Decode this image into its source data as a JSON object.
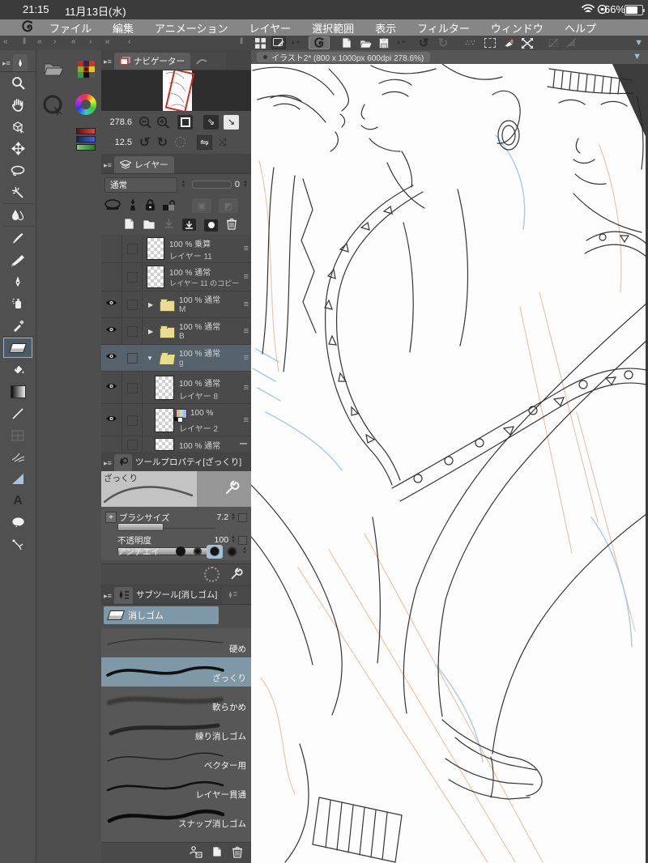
{
  "colors": {
    "selection": "#7e98a8",
    "folder_yellow": "#e6dd8f",
    "navigator_frame": "#cf2b24"
  },
  "status_bar": {
    "time": "21:15",
    "date": "11月13日(水)",
    "battery_percent": "66%"
  },
  "menu_bar": {
    "items": [
      "ファイル",
      "編集",
      "アニメーション",
      "レイヤー",
      "選択範囲",
      "表示",
      "フィルター",
      "ウィンドウ",
      "ヘルプ"
    ]
  },
  "document": {
    "tab_label": "イラスト2* (800 x 1000px 600dpi 278.6%)"
  },
  "navigator": {
    "tab": "ナビゲーター",
    "zoom_value": "278.6",
    "rotate_value": "12.5"
  },
  "layer_panel": {
    "tab": "レイヤー",
    "blend_mode": "通常",
    "opacity_value": "0",
    "rows": [
      {
        "percent": "100 %",
        "mode": "乗算",
        "name": "レイヤー 11"
      },
      {
        "percent": "100 %",
        "mode": "通常",
        "name": "レイヤー 11 のコピー"
      },
      {
        "percent": "100 %",
        "mode": "通常",
        "name": "M"
      },
      {
        "percent": "100 %",
        "mode": "通常",
        "name": "B"
      },
      {
        "percent": "100 %",
        "mode": "通常",
        "name": "g"
      },
      {
        "percent": "100 %",
        "mode": "通常",
        "name": "レイヤー 8"
      },
      {
        "percent": "100 %",
        "mode": "",
        "name": "レイヤー 2"
      },
      {
        "percent": "100 %",
        "mode": "通常",
        "name": ""
      }
    ]
  },
  "tool_property": {
    "tab": "ツールプロパティ[ざっくり]",
    "tool_name": "ざっくり",
    "brush_size_label": "ブラシサイズ",
    "brush_size_value": "7.2",
    "opacity_label": "不透明度",
    "opacity_value": "100",
    "antialias_label": "アンチエイリ"
  },
  "sub_tool": {
    "tab": "サブツール[消しゴム]",
    "group_label": "消しゴム",
    "items": [
      {
        "name": "硬め"
      },
      {
        "name": "ざっくり"
      },
      {
        "name": "軟らかめ"
      },
      {
        "name": "練り消しゴム"
      },
      {
        "name": "ベクター用"
      },
      {
        "name": "レイヤー貫通"
      },
      {
        "name": "スナップ消しゴム"
      }
    ]
  }
}
